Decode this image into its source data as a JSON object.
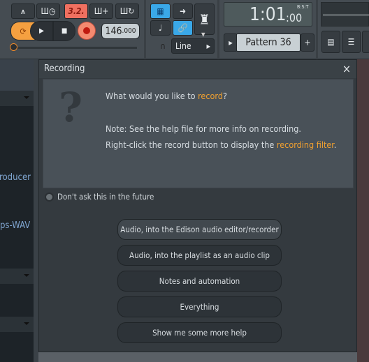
{
  "toolbar": {
    "song_position": "1:01",
    "song_position_sub": ":00",
    "time_format": "B:S:T",
    "tempo": "146",
    "tempo_decimal": ".000",
    "pattern": "Pattern 36",
    "snap": "Line",
    "typing_keyboard_label": "3.2.",
    "accent_orange": "#f08a2a",
    "accent_blue": "#3aa8e8"
  },
  "left_panel": {
    "items": [
      "roducer",
      "ps-WAV"
    ]
  },
  "dialog": {
    "title": "Recording",
    "close": "×",
    "question_prefix": "What would you like to ",
    "question_link": "record",
    "question_suffix": "?",
    "note": "Note: See the help file for more info on recording.",
    "hint_prefix": "Right-click the record button to display the ",
    "hint_link": "recording filter",
    "hint_suffix": ".",
    "dont_ask": "Don't ask this in the future",
    "options": [
      "Audio, into the Edison audio editor/recorder",
      "Audio, into the playlist as an audio clip",
      "Notes and automation",
      "Everything",
      "Show me some more help"
    ]
  }
}
